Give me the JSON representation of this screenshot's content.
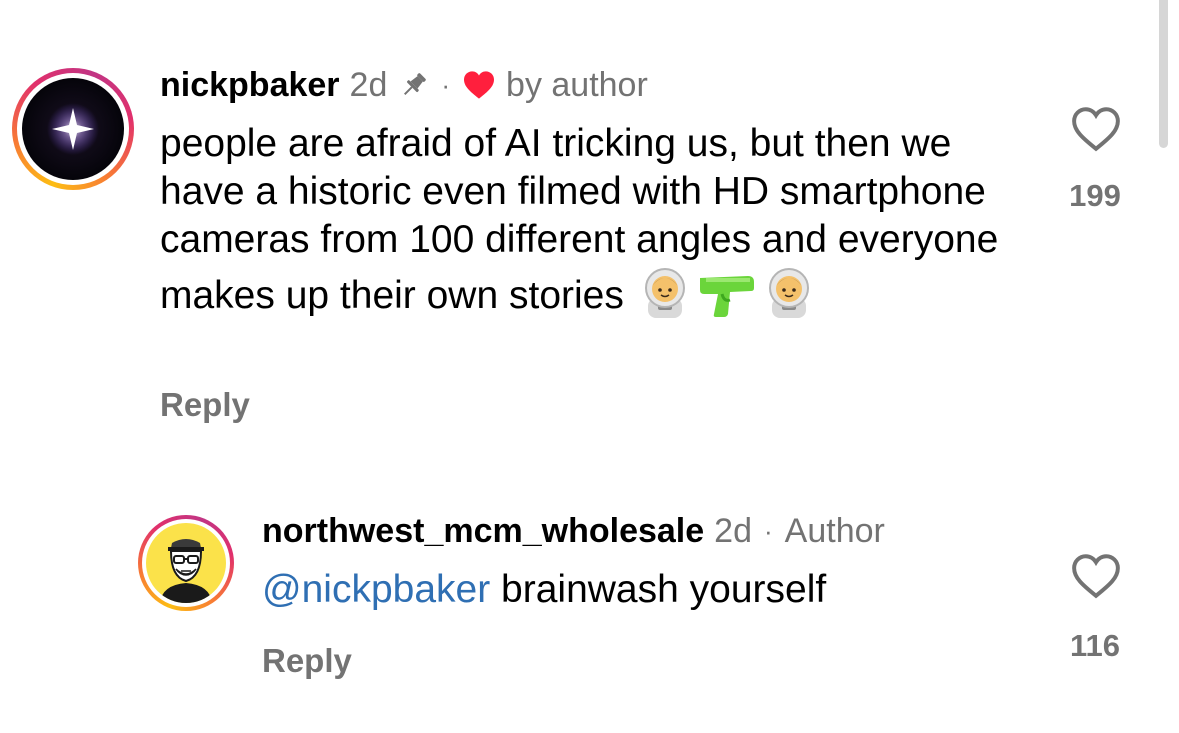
{
  "comments": [
    {
      "username": "nickpbaker",
      "time": "2d",
      "separator": "·",
      "liked_by_author_label": "by author",
      "text": "people are afraid of AI tricking us, but then we have a historic even filmed with HD smartphone cameras from 100 different angles and everyone makes up their own stories",
      "emojis": [
        "astronaut-emoji",
        "water-pistol-emoji",
        "astronaut-emoji"
      ],
      "reply_label": "Reply",
      "like_count": "199",
      "pinned": true,
      "avatar_icon": "sparkle-star-avatar"
    }
  ],
  "replies": [
    {
      "username": "northwest_mcm_wholesale",
      "time": "2d",
      "separator": "·",
      "badge": "Author",
      "mention": "@nickpbaker",
      "text": " brainwash yourself",
      "reply_label": "Reply",
      "like_count": "116",
      "avatar_icon": "cartoon-man-avatar"
    }
  ],
  "colors": {
    "muted": "#737373",
    "mention": "#2f6fb3",
    "heart": "#ff3040"
  }
}
